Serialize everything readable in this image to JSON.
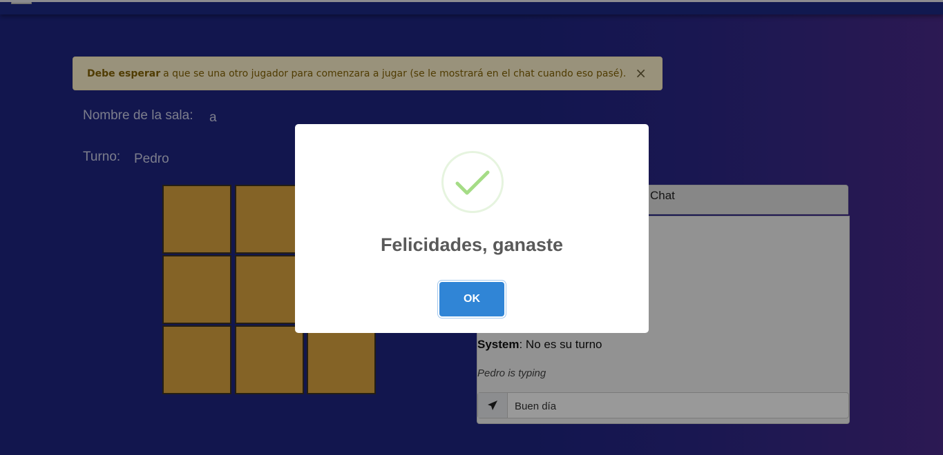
{
  "alert": {
    "strong": "Debe esperar",
    "text": "a que se una otro jugador para comenzara a jugar (se le mostrará en el chat cuando eso pasé).",
    "close": "×"
  },
  "room": {
    "label": "Nombre de la sala:",
    "value": "a"
  },
  "turn": {
    "label": "Turno:",
    "value": "Pedro"
  },
  "board": {
    "rows": 3,
    "cols": 3,
    "cell_color": "#dca540"
  },
  "chat": {
    "title": "Chat",
    "messages": [
      {
        "sender": "System",
        "text": ": No es su turno"
      }
    ],
    "typing": "Pedro is typing",
    "input_value": "Buen día",
    "send_icon": "paper-plane-icon"
  },
  "modal": {
    "icon": "success-check-icon",
    "title": "Felicidades, ganaste",
    "ok_label": "OK"
  },
  "colors": {
    "background": "#1e2683",
    "accent": "#3085d6",
    "success": "#a5dc86",
    "alert_bg": "#fff3cd"
  }
}
